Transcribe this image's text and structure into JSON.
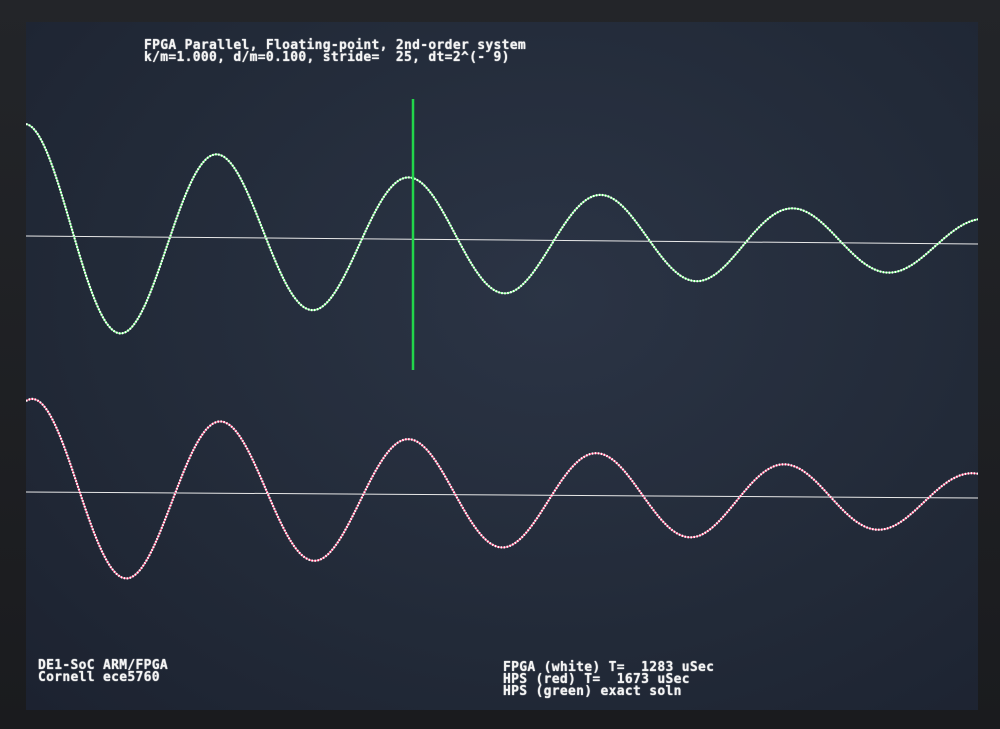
{
  "header": {
    "title_line": "FPGA Parallel, Floating-point, 2nd-order system",
    "params_line": "k/m=1.000, d/m=0.100, stride=  25, dt=2^(- 9)"
  },
  "footer_left": {
    "line1": "DE1-SoC ARM/FPGA",
    "line2": "Cornell ece5760"
  },
  "footer_right": {
    "line1": "FPGA (white) T=  1283 uSec",
    "line2": "HPS (red) T=  1673 uSec",
    "line3": "HPS (green) exact soln"
  },
  "trace_colors": {
    "fpga": "#ffffff",
    "hps": "#ff5a8a",
    "exact": "#7cff8a",
    "axis": "#e8e8e8",
    "cursor": "#22d64a"
  }
}
